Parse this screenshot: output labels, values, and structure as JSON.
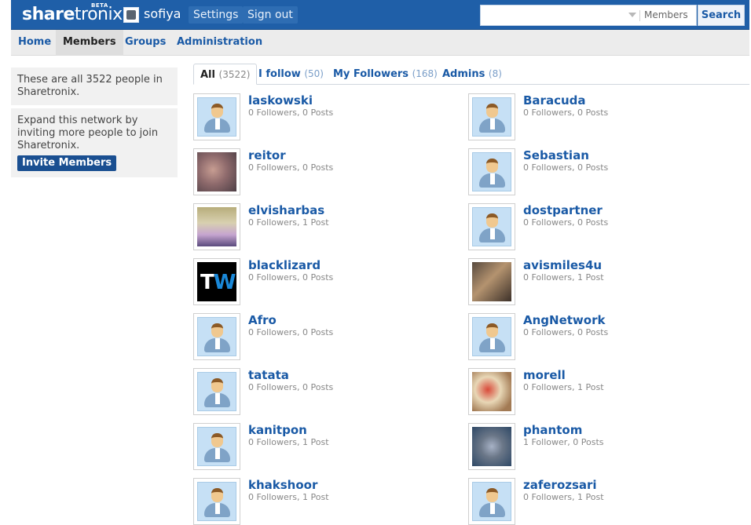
{
  "header": {
    "logo_text_bold": "share",
    "logo_text_light": "tronix",
    "logo_badge": "BETA",
    "username": "sofiya",
    "settings_label": "Settings",
    "signout_label": "Sign out",
    "search_placeholder": "",
    "search_scope": "Members",
    "search_button": "Search"
  },
  "nav": {
    "items": [
      {
        "label": "Home"
      },
      {
        "label": "Members"
      },
      {
        "label": "Groups"
      },
      {
        "label": "Administration"
      }
    ]
  },
  "sidebar": {
    "info_text": "These are all 3522 people in Sharetronix.",
    "invite_text": "Expand this network by inviting more people to join Sharetronix.",
    "invite_button": "Invite Members"
  },
  "tabs": [
    {
      "label": "All",
      "count": "(3522)"
    },
    {
      "label": "I follow",
      "count": "(50)"
    },
    {
      "label": "My Followers",
      "count": "(168)"
    },
    {
      "label": "Admins",
      "count": "(8)"
    }
  ],
  "members": [
    {
      "name": "laskowski",
      "stats": "0 Followers, 0 Posts",
      "avatar": "default-avatar-icon"
    },
    {
      "name": "Baracuda",
      "stats": "0 Followers, 0 Posts",
      "avatar": "default-avatar-icon"
    },
    {
      "name": "reitor",
      "stats": "0 Followers, 0 Posts",
      "avatar": "photo"
    },
    {
      "name": "Sebastian",
      "stats": "0 Followers, 0 Posts",
      "avatar": "default-avatar-icon"
    },
    {
      "name": "elvisharbas",
      "stats": "0 Followers, 1 Post",
      "avatar": "photo"
    },
    {
      "name": "dostpartner",
      "stats": "0 Followers, 0 Posts",
      "avatar": "default-avatar-icon"
    },
    {
      "name": "blacklizard",
      "stats": "0 Followers, 0 Posts",
      "avatar": "tw-logo"
    },
    {
      "name": "avismiles4u",
      "stats": "0 Followers, 1 Post",
      "avatar": "photo"
    },
    {
      "name": "Afro",
      "stats": "0 Followers, 0 Posts",
      "avatar": "default-avatar-icon"
    },
    {
      "name": "AngNetwork",
      "stats": "0 Followers, 0 Posts",
      "avatar": "default-avatar-icon"
    },
    {
      "name": "tatata",
      "stats": "0 Followers, 0 Posts",
      "avatar": "default-avatar-icon"
    },
    {
      "name": "morell",
      "stats": "0 Followers, 1 Post",
      "avatar": "photo"
    },
    {
      "name": "kanitpon",
      "stats": "0 Followers, 1 Post",
      "avatar": "default-avatar-icon"
    },
    {
      "name": "phantom",
      "stats": "1 Follower, 0 Posts",
      "avatar": "photo"
    },
    {
      "name": "khakshoor",
      "stats": "0 Followers, 1 Post",
      "avatar": "default-avatar-icon"
    },
    {
      "name": "zaferozsari",
      "stats": "0 Followers, 1 Post",
      "avatar": "default-avatar-icon"
    }
  ],
  "colors": {
    "brand_blue": "#1f5fa8",
    "link_blue": "#1a5aa6",
    "button_dark_blue": "#1a4f91"
  }
}
